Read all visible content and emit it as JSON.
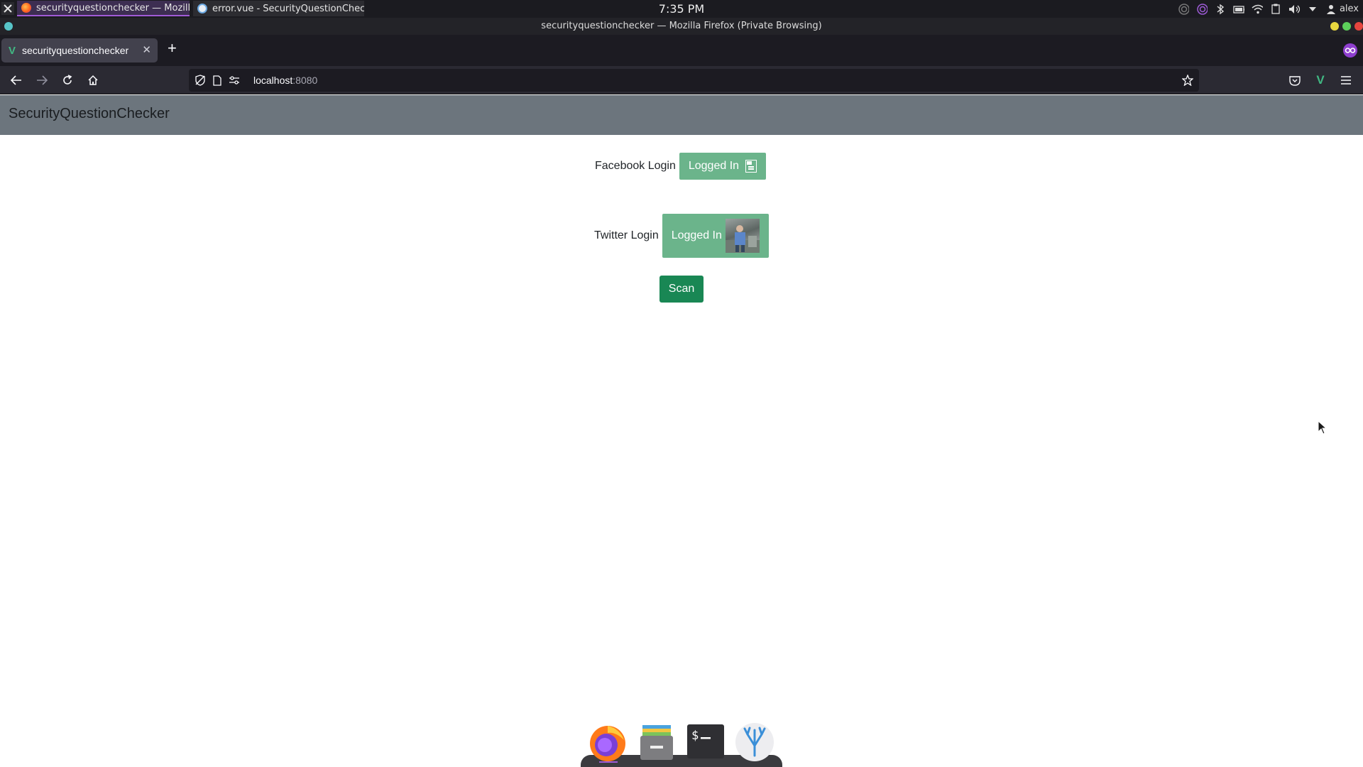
{
  "system": {
    "clock": "7:35 PM",
    "user": "alex",
    "tasks": [
      {
        "label": "securityquestionchecker — Mozill..."
      },
      {
        "label": "error.vue - SecurityQuestionChec..."
      }
    ]
  },
  "window": {
    "title": "securityquestionchecker — Mozilla Firefox (Private Browsing)"
  },
  "browser": {
    "tab_title": "securityquestionchecker",
    "url_host": "localhost",
    "url_port": ":8080"
  },
  "app": {
    "brand": "SecurityQuestionChecker",
    "facebook": {
      "label": "Facebook Login",
      "status": "Logged In"
    },
    "twitter": {
      "label": "Twitter Login",
      "status": "Logged In"
    },
    "scan_label": "Scan"
  },
  "colors": {
    "navbar": "#6c757d",
    "logged_in_button": "#6bb48b",
    "scan_button": "#198754"
  },
  "dock": {
    "items": [
      "firefox-icon",
      "files-icon",
      "terminal-icon",
      "vscodium-icon"
    ]
  }
}
